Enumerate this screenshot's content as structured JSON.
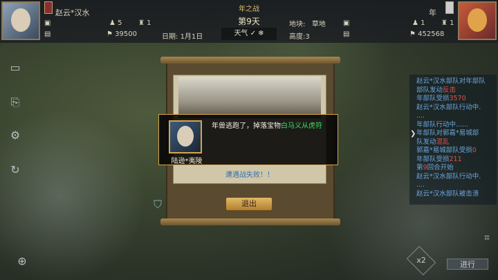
{
  "header": {
    "battle_title": "年之战",
    "day": "第9天",
    "weather_label": "天气",
    "terrain_label": "地块:",
    "terrain_value": "草地",
    "height_label": "高度:3",
    "date_label": "日期:",
    "date_value": "1月1日"
  },
  "player_left": {
    "name": "赵云*汉水",
    "units": "5",
    "generals": "1",
    "troops": "39500"
  },
  "player_right": {
    "name": "年",
    "units": "1",
    "generals": "1",
    "troops": "452568"
  },
  "dialog": {
    "message_prefix": "年兽逃跑了，掉落宝物",
    "treasure_name": "白马义从虎符",
    "hero_name": "陆逊*夷陵",
    "fail_text": "遭遇战失败！！",
    "exit_label": "退出"
  },
  "battle_log": {
    "lines": [
      {
        "text": "赵云*汉水部队对年部队",
        "num": ""
      },
      {
        "text": "部队发动",
        "num": "反击"
      },
      {
        "text": "年部队受损",
        "num": "3570"
      },
      {
        "text": "赵云*汉水部队行动中.",
        "num": ""
      },
      {
        "text": "....",
        "num": ""
      },
      {
        "text": "年部队行动中......",
        "num": ""
      },
      {
        "text": "年部队对郭嘉*易城部",
        "num": ""
      },
      {
        "text": "队发动",
        "num": "混乱"
      },
      {
        "text": "郭嘉*易城部队受损",
        "num": "0"
      },
      {
        "text": "年部队受损",
        "num": "211"
      },
      {
        "text": "第",
        "num": "9"
      },
      {
        "text": "赵云*汉水部队行动中.",
        "num": ""
      },
      {
        "text": "....",
        "num": ""
      },
      {
        "text": "赵云*汉水部队被击溃",
        "num": ""
      }
    ],
    "round_suffix": "回合开始"
  },
  "controls": {
    "speed": "x2",
    "proceed": "进行"
  },
  "icons": [
    "screen-icon",
    "book-icon",
    "gear-icon",
    "refresh-icon",
    "zoom-icon",
    "shield-icon"
  ],
  "colors": {
    "treasure": "#3be05e",
    "log_blue": "#6aa6e0",
    "log_red": "#e05050",
    "gold": "#d8a44c"
  }
}
